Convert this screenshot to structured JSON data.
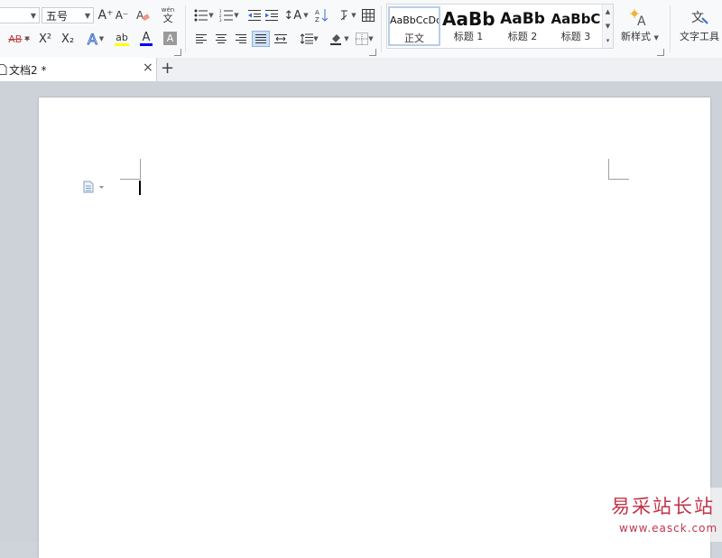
{
  "ribbon": {
    "font_size_value": "五号",
    "superscript_label": "X²",
    "subscript_label": "X₂",
    "strikethrough_label": "AB",
    "text_effect_label": "A",
    "highlight_label": "ab",
    "font_color_label": "A",
    "char_shading_label": "A",
    "grow_font_label": "A⁺",
    "shrink_font_label": "A⁻",
    "phonetic_label": "wén",
    "phonetic_char": "文",
    "styles": [
      {
        "preview": "AaBbCcDd",
        "name": "正文"
      },
      {
        "preview": "AaBb",
        "name": "标题 1"
      },
      {
        "preview": "AaBb",
        "name": "标题 2"
      },
      {
        "preview": "AaBbC",
        "name": "标题 3"
      }
    ],
    "new_style_label": "新样式",
    "text_tools_label": "文字工具",
    "colors": {
      "highlight": "#ffff00",
      "font_color": "#ff0000",
      "text_effect": "#3a6ec9"
    }
  },
  "tabs": [
    {
      "label": "文档2 *"
    }
  ],
  "tab_close": "×",
  "new_tab": "+",
  "watermark": {
    "text": "易采站长站",
    "url": "www.easck.com"
  }
}
